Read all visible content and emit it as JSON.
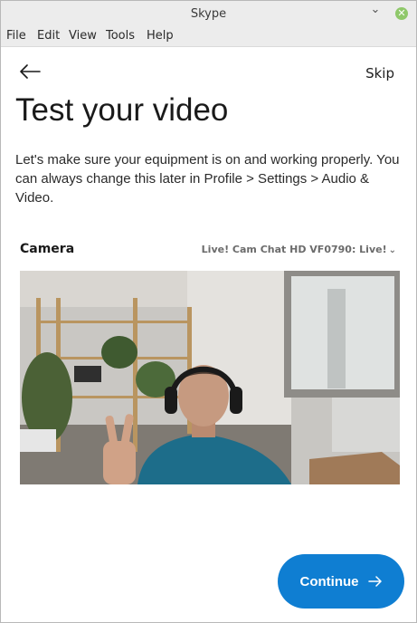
{
  "window": {
    "title": "Skype"
  },
  "menubar": {
    "items": [
      "File",
      "Edit",
      "View",
      "Tools",
      "Help"
    ]
  },
  "nav": {
    "back_icon": "arrow-left-icon",
    "skip_label": "Skip"
  },
  "page": {
    "title": "Test your video",
    "description": "Let's make sure your equipment is on and working properly. You can always change this later in Profile > Settings > Audio & Video."
  },
  "camera": {
    "label": "Camera",
    "selected_device": "Live! Cam Chat HD VF0790: Live!",
    "dropdown_icon": "chevron-down-icon"
  },
  "actions": {
    "continue_label": "Continue",
    "continue_icon": "arrow-right-icon"
  },
  "colors": {
    "accent": "#0f7ed2",
    "titlebar": "#ececec",
    "close_button": "#8fc86a"
  }
}
